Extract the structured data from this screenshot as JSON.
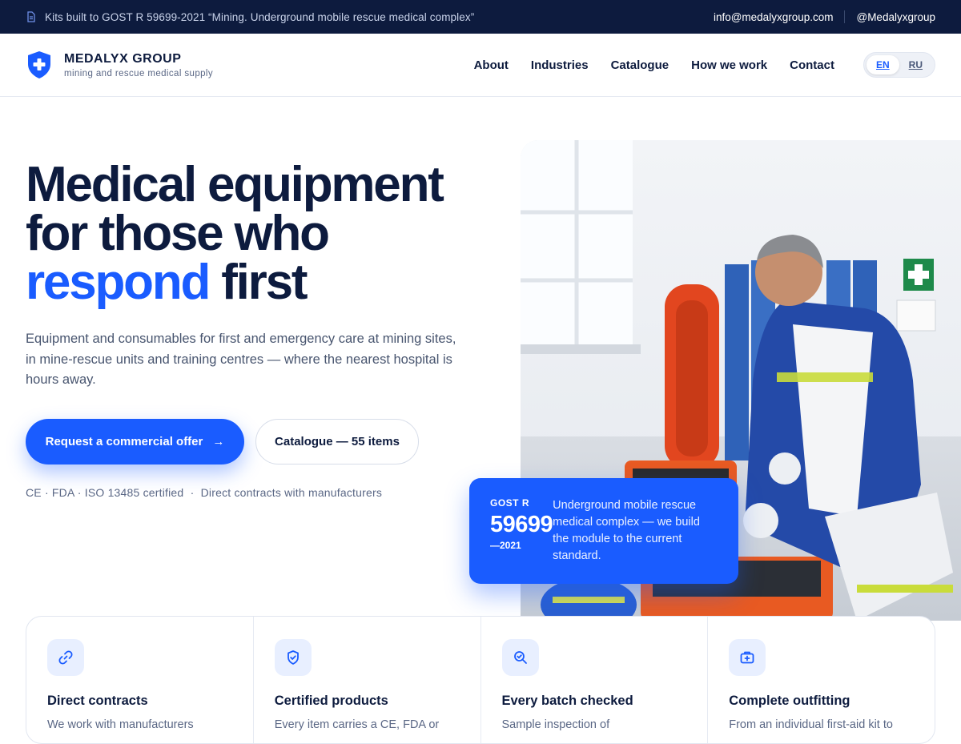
{
  "topbar": {
    "notice": "Kits built to GOST R 59699-2021 “Mining. Underground mobile rescue medical complex”",
    "email": "info@medalyxgroup.com",
    "handle": "@Medalyxgroup"
  },
  "brand": {
    "name": "MEDALYX GROUP",
    "tagline": "mining and rescue medical supply",
    "accent_color": "#1a5cff",
    "navy_color": "#0d1b3e"
  },
  "nav": {
    "items": [
      "About",
      "Industries",
      "Catalogue",
      "How we work",
      "Contact"
    ],
    "lang": {
      "en": "EN",
      "ru": "RU",
      "active": "EN"
    }
  },
  "hero": {
    "title_line1": "Medical equipment",
    "title_line2": "for those who",
    "title_accent": "respond",
    "title_end": " first",
    "lead": "Equipment and consumables for first and emergency care at mining sites, in mine-rescue units and training centres — where the nearest hospital is hours away.",
    "primary_cta": "Request a commercial offer",
    "secondary_cta": "Catalogue — 55 items",
    "certs": "CE · FDA · ISO 13485 certified  ·  Direct contracts with manufacturers"
  },
  "gost_card": {
    "label": "GOST R",
    "number": "59699",
    "year": "—2021",
    "text": "Underground mobile rescue medical complex — we build the module to the current standard."
  },
  "features": [
    {
      "icon": "link-icon",
      "title": "Direct contracts",
      "text": "We work with manufacturers"
    },
    {
      "icon": "shield-check-icon",
      "title": "Certified products",
      "text": "Every item carries a CE, FDA or"
    },
    {
      "icon": "search-icon",
      "title": "Every batch checked",
      "text": "Sample inspection of"
    },
    {
      "icon": "medkit-icon",
      "title": "Complete outfitting",
      "text": "From an individual first-aid kit to"
    }
  ]
}
